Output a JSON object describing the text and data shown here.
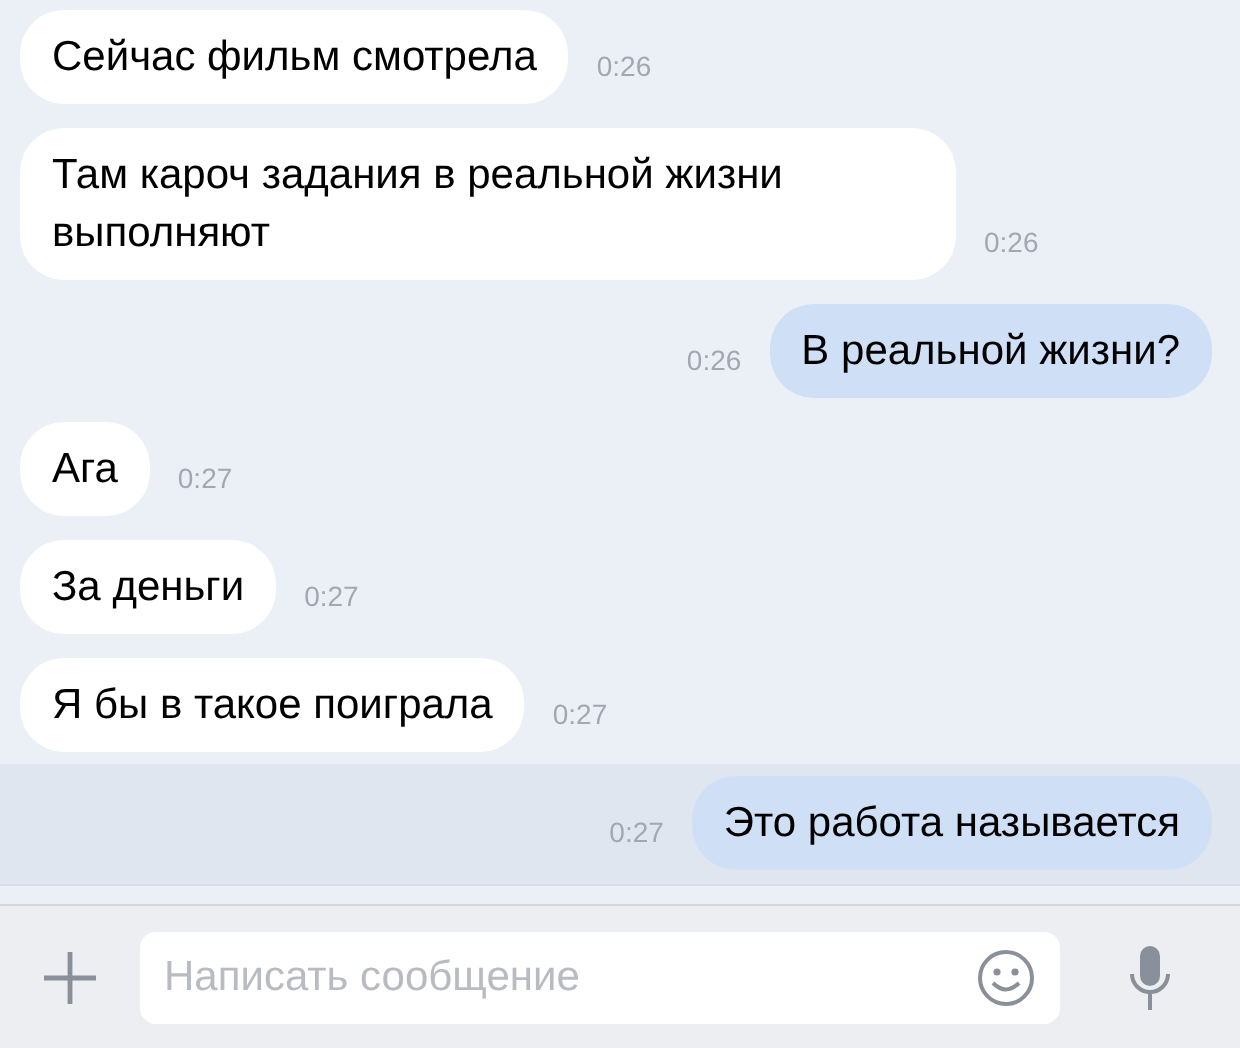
{
  "messages": [
    {
      "kind": "incoming",
      "text": "Сейчас фильм смотрела",
      "time": "0:26",
      "highlighted": false
    },
    {
      "kind": "incoming",
      "text": "Там кароч задания в реальной жизни выполняют",
      "time": "0:26",
      "highlighted": false
    },
    {
      "kind": "outgoing",
      "text": "В реальной жизни?",
      "time": "0:26",
      "highlighted": false
    },
    {
      "kind": "incoming",
      "text": "Ага",
      "time": "0:27",
      "highlighted": false
    },
    {
      "kind": "incoming",
      "text": "За деньги",
      "time": "0:27",
      "highlighted": false
    },
    {
      "kind": "incoming",
      "text": "Я бы в такое поиграла",
      "time": "0:27",
      "highlighted": false
    },
    {
      "kind": "outgoing",
      "text": "Это работа называется",
      "time": "0:27",
      "highlighted": true
    }
  ],
  "composer": {
    "placeholder": "Написать сообщение"
  }
}
